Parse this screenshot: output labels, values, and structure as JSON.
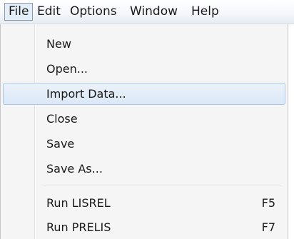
{
  "menubar": {
    "items": [
      {
        "label": "File"
      },
      {
        "label": "Edit"
      },
      {
        "label": "Options"
      },
      {
        "label": "Window"
      },
      {
        "label": "Help"
      }
    ],
    "active": "File"
  },
  "file_menu": {
    "items": [
      {
        "label": "New"
      },
      {
        "label": "Open..."
      },
      {
        "label": "Import Data...",
        "highlighted": true
      },
      {
        "label": "Close"
      },
      {
        "label": "Save"
      },
      {
        "label": "Save As..."
      },
      {
        "label": "Run LISREL",
        "shortcut": "F5"
      },
      {
        "label": "Run PRELIS",
        "shortcut": "F7"
      }
    ]
  }
}
